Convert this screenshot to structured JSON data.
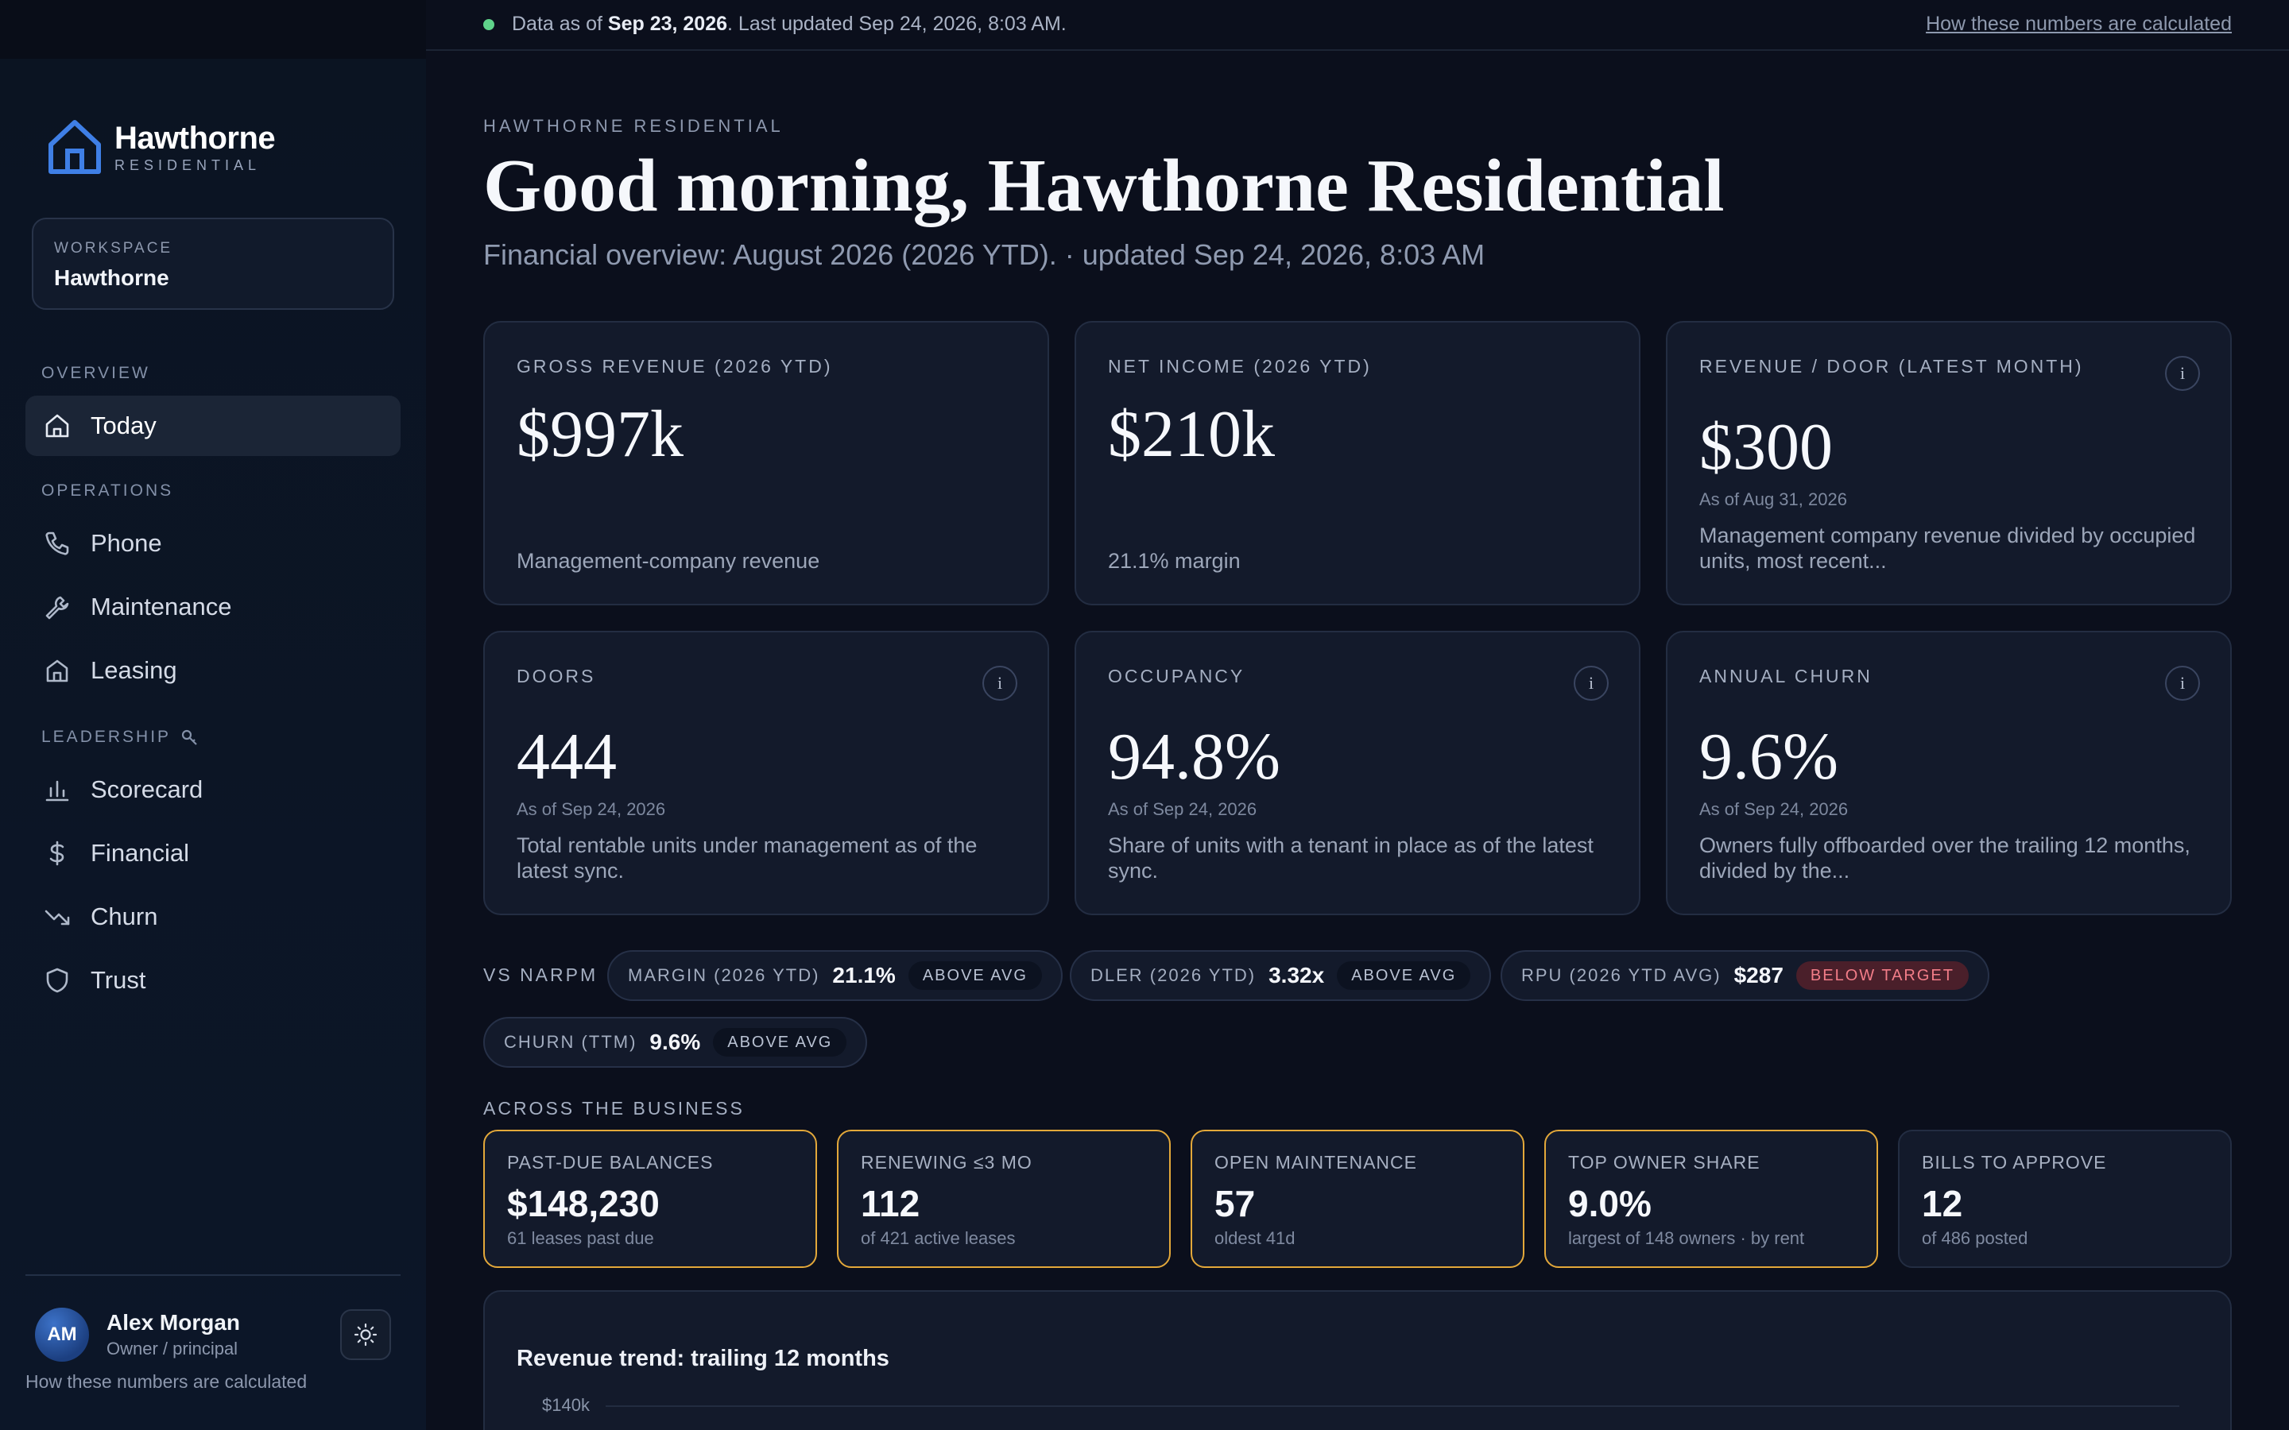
{
  "topbar": {
    "prefix": "Data as of ",
    "as_of_date": "Sep 23, 2026",
    "suffix": ". Last updated Sep 24, 2026, 8:03 AM.",
    "link": "How these numbers are calculated"
  },
  "brand": {
    "name": "Hawthorne",
    "subtitle": "RESIDENTIAL"
  },
  "workspace": {
    "label": "WORKSPACE",
    "name": "Hawthorne"
  },
  "nav": {
    "overview_label": "OVERVIEW",
    "operations_label": "OPERATIONS",
    "leadership_label": "LEADERSHIP",
    "items": [
      {
        "label": "Today",
        "icon": "home-icon",
        "active": true
      },
      {
        "label": "Phone",
        "icon": "phone-icon"
      },
      {
        "label": "Maintenance",
        "icon": "wrench-icon"
      },
      {
        "label": "Leasing",
        "icon": "building-icon"
      },
      {
        "label": "Scorecard",
        "icon": "bar-chart-icon"
      },
      {
        "label": "Financial",
        "icon": "dollar-icon"
      },
      {
        "label": "Churn",
        "icon": "trending-down-icon"
      },
      {
        "label": "Trust",
        "icon": "shield-icon"
      }
    ]
  },
  "user": {
    "initials": "AM",
    "name": "Alex Morgan",
    "role": "Owner / principal"
  },
  "sidebar_footnote": "How these numbers are calculated",
  "header": {
    "eyebrow": "HAWTHORNE RESIDENTIAL",
    "title": "Good morning, Hawthorne Residential",
    "subtitle": "Financial overview: August 2026 (2026 YTD). · updated Sep 24, 2026, 8:03 AM"
  },
  "kpis": [
    {
      "label": "GROSS REVENUE (2026 YTD)",
      "value": "$997k",
      "asof": "",
      "desc": "Management-company revenue"
    },
    {
      "label": "NET INCOME (2026 YTD)",
      "value": "$210k",
      "asof": "",
      "desc": "21.1% margin"
    },
    {
      "label": "REVENUE / DOOR (LATEST MONTH)",
      "value": "$300",
      "asof": "As of Aug 31, 2026",
      "desc": "Management company revenue divided by occupied units, most recent..."
    },
    {
      "label": "DOORS",
      "value": "444",
      "asof": "As of Sep 24, 2026",
      "desc": "Total rentable units under management as of the latest sync."
    },
    {
      "label": "OCCUPANCY",
      "value": "94.8%",
      "asof": "As of Sep 24, 2026",
      "desc": "Share of units with a tenant in place as of the latest sync."
    },
    {
      "label": "ANNUAL CHURN",
      "value": "9.6%",
      "asof": "As of Sep 24, 2026",
      "desc": "Owners fully offboarded over the trailing 12 months, divided by the..."
    }
  ],
  "benchmarks": {
    "label": "VS NARPM",
    "items": [
      {
        "label": "MARGIN (2026 YTD)",
        "value": "21.1%",
        "badge": "ABOVE AVG",
        "status": "good"
      },
      {
        "label": "DLER (2026 YTD)",
        "value": "3.32x",
        "badge": "ABOVE AVG",
        "status": "good"
      },
      {
        "label": "RPU (2026 YTD AVG)",
        "value": "$287",
        "badge": "BELOW TARGET",
        "status": "bad"
      },
      {
        "label": "CHURN (TTM)",
        "value": "9.6%",
        "badge": "ABOVE AVG",
        "status": "good"
      }
    ]
  },
  "business": {
    "label": "ACROSS THE BUSINESS",
    "items": [
      {
        "label": "PAST-DUE BALANCES",
        "value": "$148,230",
        "sub": "61 leases past due",
        "highlight": true
      },
      {
        "label": "RENEWING ≤3 MO",
        "value": "112",
        "sub": "of 421 active leases",
        "highlight": true
      },
      {
        "label": "OPEN MAINTENANCE",
        "value": "57",
        "sub": "oldest 41d",
        "highlight": true
      },
      {
        "label": "TOP OWNER SHARE",
        "value": "9.0%",
        "sub": "largest of 148 owners · by rent",
        "highlight": true
      },
      {
        "label": "BILLS TO APPROVE",
        "value": "12",
        "sub": "of 486 posted",
        "highlight": false
      }
    ]
  },
  "trend": {
    "title": "Revenue trend: trailing 12 months",
    "tick_top": "$140k"
  },
  "colors": {
    "accent": "#3b82f6",
    "warning_border": "#e3a83a",
    "status_ok": "#5fd38a",
    "bad_badge": "#f27d88"
  }
}
